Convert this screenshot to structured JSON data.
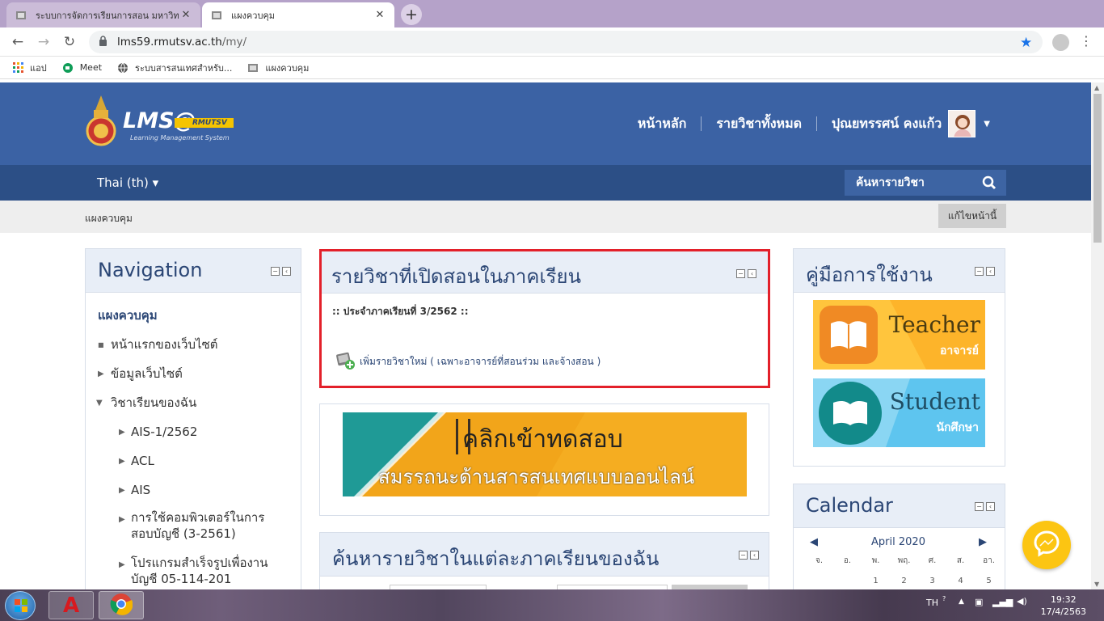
{
  "browser": {
    "tabs": [
      {
        "title": "ระบบการจัดการเรียนการสอน มหาวิทย",
        "active": false
      },
      {
        "title": "แผงควบคุม",
        "active": true
      }
    ],
    "url_host": "lms59.rmutsv.ac.th",
    "url_path": "/my/",
    "bookmarks": [
      {
        "label": "แอป",
        "icon": "apps-grid-icon"
      },
      {
        "label": "Meet",
        "icon": "meet-icon"
      },
      {
        "label": "ระบบสารสนเทศสำหรับ...",
        "icon": "globe-icon"
      },
      {
        "label": "แผงควบคุม",
        "icon": "moodle-favicon-icon"
      }
    ]
  },
  "header": {
    "logo_text": "LMS@",
    "logo_badge": "RMUTSV",
    "logo_sub": "Learning Management System",
    "nav": [
      "หน้าหลัก",
      "รายวิชาทั้งหมด"
    ],
    "user_name": "ปุณยทรรศน์ คงแก้ว"
  },
  "subnav": {
    "language": "Thai (th) ▾",
    "search_label": "ค้นหารายวิชา"
  },
  "breadcrumb": {
    "current": "แผงควบคุม",
    "edit_button": "แก้ไขหน้านี้"
  },
  "navigation_block": {
    "title": "Navigation",
    "items": [
      {
        "label": "แผงควบคุม",
        "level": 0,
        "marker": "none"
      },
      {
        "label": "หน้าแรกของเว็บไซต์",
        "level": 0,
        "marker": "bullet"
      },
      {
        "label": "ข้อมูลเว็บไซต์",
        "level": 0,
        "marker": "right"
      },
      {
        "label": "วิชาเรียนของฉัน",
        "level": 0,
        "marker": "down"
      },
      {
        "label": "AIS-1/2562",
        "level": 1,
        "marker": "right"
      },
      {
        "label": "ACL",
        "level": 1,
        "marker": "right"
      },
      {
        "label": "AIS",
        "level": 1,
        "marker": "right"
      },
      {
        "label": "การใช้คอมพิวเตอร์ในการ",
        "label2": "สอบบัญชี (3-2561)",
        "level": 1,
        "marker": "right"
      },
      {
        "label": "โปรแกรมสำเร็จรูปเพื่องาน",
        "label2": "บัญชี 05-114-201",
        "level": 1,
        "marker": "right"
      }
    ]
  },
  "courses_block": {
    "title": "รายวิชาที่เปิดสอนในภาคเรียน",
    "semester_line": ":: ประจำภาคเรียนที่ 3/2562 ::",
    "add_course_link": "เพิ่มรายวิชาใหม่ ( เฉพาะอาจารย์ที่สอนร่วม และจ้างสอน )",
    "highlight_color": "#e3202a"
  },
  "exam_banner": {
    "line1": "คลิกเข้าทดสอบ",
    "line2": "สมรรถนะด้านสารสนเทศแบบออนไลน์",
    "colors": {
      "teal": "#1f9a96",
      "orange": "#f2a51a"
    }
  },
  "search_semester_block": {
    "title": "ค้นหารายวิชาในแต่ละภาคเรียนของฉัน"
  },
  "manual_block": {
    "title": "คู่มือการใช้งาน",
    "teacher_en": "Teacher",
    "teacher_th": "อาจารย์",
    "student_en": "Student",
    "student_th": "นักศึกษา"
  },
  "calendar_block": {
    "title": "Calendar",
    "month": "April 2020",
    "dows": [
      "จ.",
      "อ.",
      "พ.",
      "พฤ.",
      "ศ.",
      "ส.",
      "อา."
    ],
    "first_row": [
      "",
      "",
      "1",
      "2",
      "3",
      "4",
      "5"
    ]
  },
  "taskbar": {
    "lang": "TH",
    "time": "19:32",
    "date": "17/4/2563"
  },
  "colors": {
    "header_blue": "#3b62a4",
    "subnav_blue": "#2c4f86",
    "block_title": "#2b4675"
  }
}
